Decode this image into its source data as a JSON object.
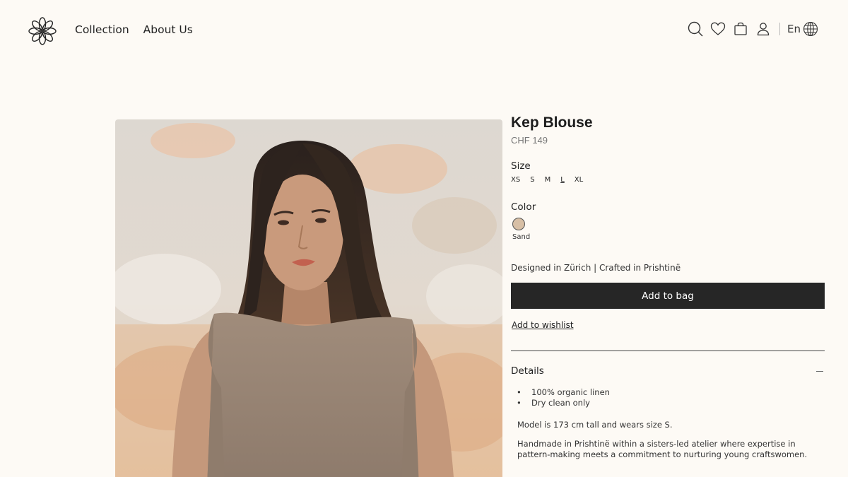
{
  "header": {
    "logo_icon": "flower-logo",
    "nav": [
      {
        "label": "Collection"
      },
      {
        "label": "About Us"
      }
    ],
    "icons": [
      "search-icon",
      "heart-icon",
      "bag-icon",
      "user-icon",
      "globe-icon"
    ],
    "language": "En"
  },
  "product": {
    "title": "Kep Blouse",
    "price": "CHF 149",
    "size_label": "Size",
    "sizes": [
      "XS",
      "S",
      "M",
      "L",
      "XL"
    ],
    "selected_size": "L",
    "color_label": "Color",
    "color_name": "Sand",
    "color_hex": "#d7bfa5",
    "origin": "Designed in Zürich | Crafted in Prishtinë",
    "add_to_bag": "Add to bag",
    "add_to_wishlist": "Add to wishlist",
    "details_label": "Details",
    "details": [
      "100% organic linen",
      "Dry clean only"
    ],
    "model_note": "Model is 173 cm tall and wears size S.",
    "handmade_note": "Handmade in Prishtinë within a sisters-led atelier where expertise in pattern-making meets a commitment to nurturing young craftswomen."
  },
  "colors": {
    "background": "#fdfaf5",
    "button": "#262626",
    "text": "#222222"
  }
}
